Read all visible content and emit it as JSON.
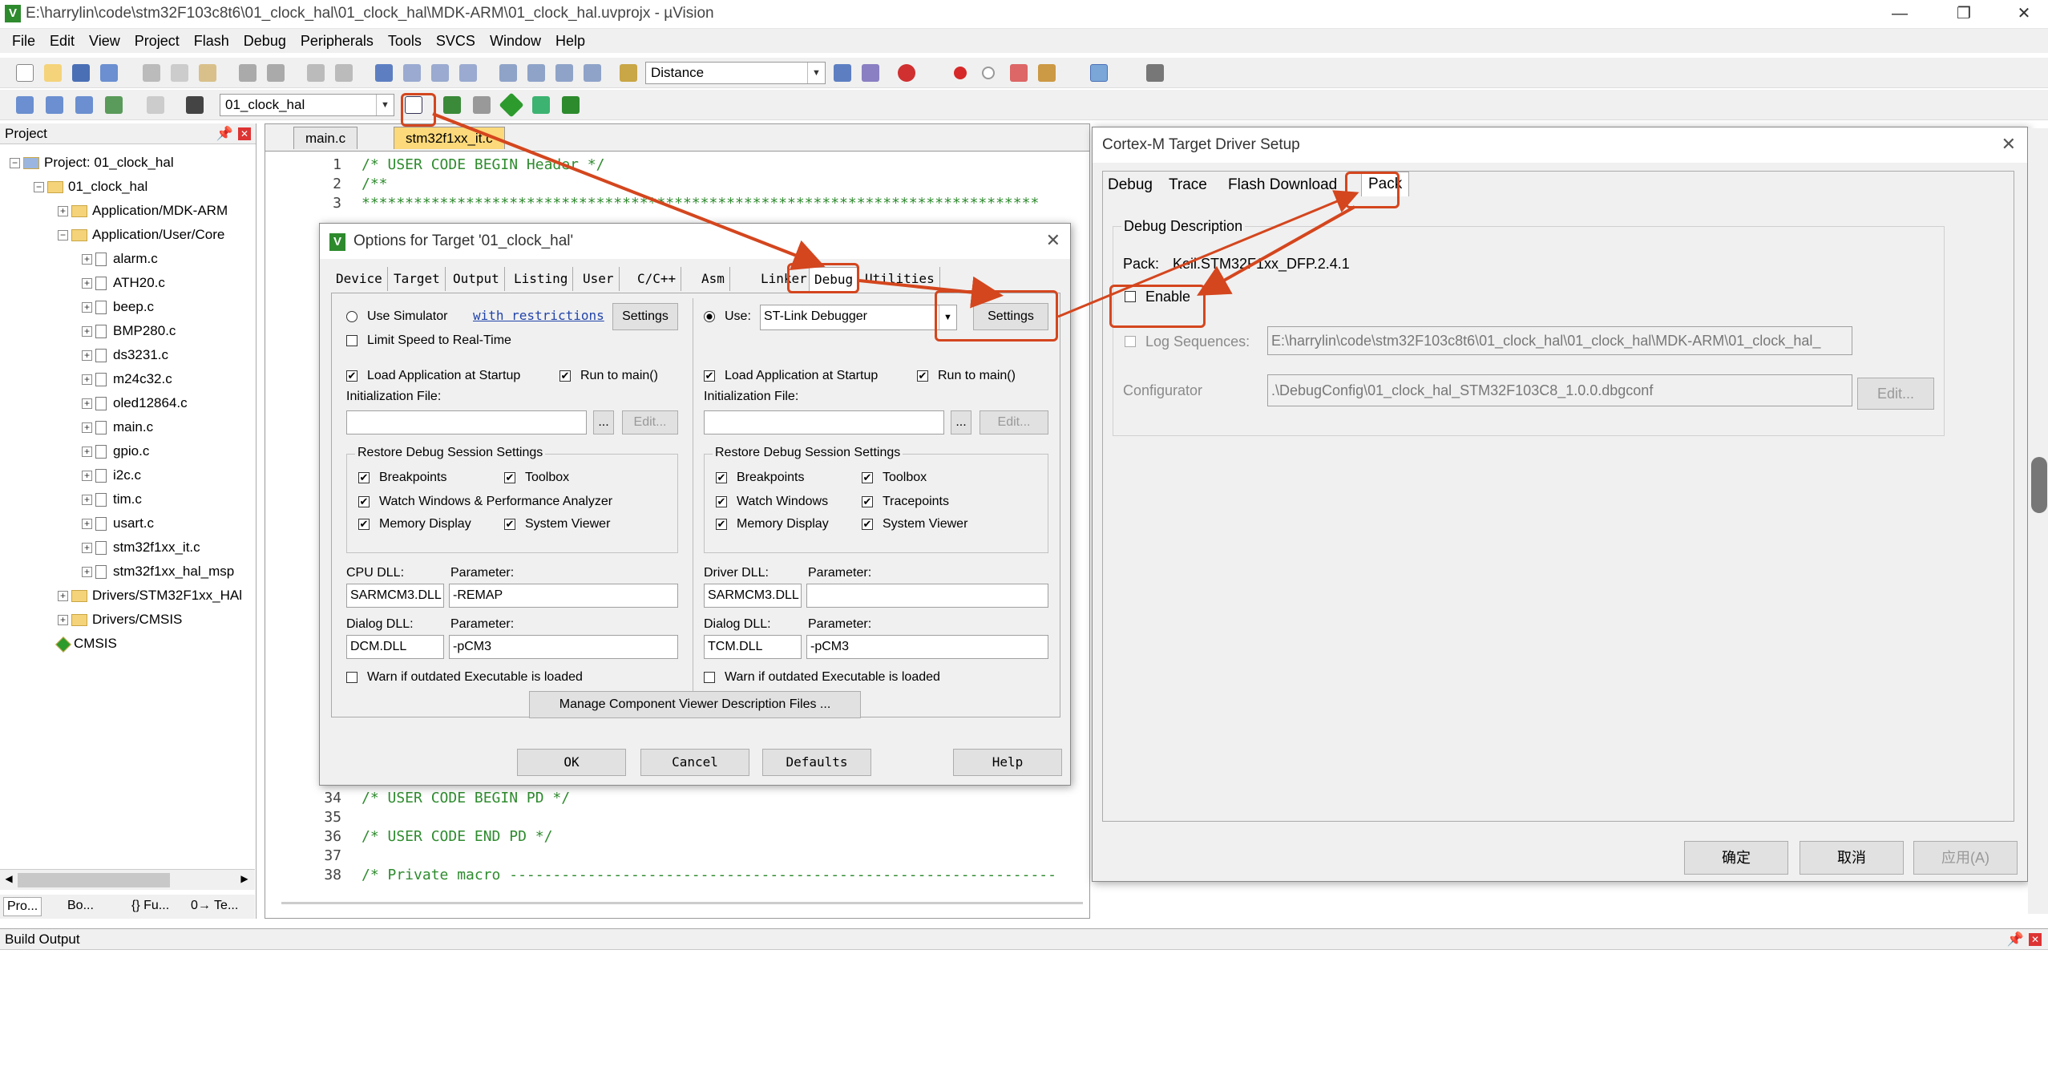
{
  "window": {
    "title": "E:\\harrylin\\code\\stm32F103c8t6\\01_clock_hal\\01_clock_hal\\MDK-ARM\\01_clock_hal.uvprojx - µVision",
    "app_icon": "V",
    "minimize_glyph": "—",
    "maximize_glyph": "❐",
    "close_glyph": "✕"
  },
  "menu": [
    "File",
    "Edit",
    "View",
    "Project",
    "Flash",
    "Debug",
    "Peripherals",
    "Tools",
    "SVCS",
    "Window",
    "Help"
  ],
  "toolbar": {
    "find_combo_value": "Distance",
    "target_combo_value": "01_clock_hal"
  },
  "project_panel": {
    "title": "Project",
    "items": [
      {
        "label": "Project: 01_clock_hal",
        "type": "root",
        "expander": "⊟"
      },
      {
        "label": "01_clock_hal",
        "type": "target",
        "expander": "⊟"
      },
      {
        "label": "Application/MDK-ARM",
        "type": "folder",
        "expander": "⊞"
      },
      {
        "label": "Application/User/Core",
        "type": "folder",
        "expander": "⊟"
      },
      {
        "label": "alarm.c",
        "type": "file",
        "expander": "⊞"
      },
      {
        "label": "ATH20.c",
        "type": "file",
        "expander": "⊞"
      },
      {
        "label": "beep.c",
        "type": "file",
        "expander": "⊞"
      },
      {
        "label": "BMP280.c",
        "type": "file",
        "expander": "⊞"
      },
      {
        "label": "ds3231.c",
        "type": "file",
        "expander": "⊞"
      },
      {
        "label": "m24c32.c",
        "type": "file",
        "expander": "⊞"
      },
      {
        "label": "oled12864.c",
        "type": "file",
        "expander": "⊞"
      },
      {
        "label": "main.c",
        "type": "file",
        "expander": "⊞"
      },
      {
        "label": "gpio.c",
        "type": "file",
        "expander": "⊞"
      },
      {
        "label": "i2c.c",
        "type": "file",
        "expander": "⊞"
      },
      {
        "label": "tim.c",
        "type": "file",
        "expander": "⊞"
      },
      {
        "label": "usart.c",
        "type": "file",
        "expander": "⊞"
      },
      {
        "label": "stm32f1xx_it.c",
        "type": "file",
        "expander": "⊞"
      },
      {
        "label": "stm32f1xx_hal_msp",
        "type": "file",
        "expander": "⊞"
      },
      {
        "label": "Drivers/STM32F1xx_HAl",
        "type": "folder",
        "expander": "⊞"
      },
      {
        "label": "Drivers/CMSIS",
        "type": "folder",
        "expander": "⊞"
      },
      {
        "label": "CMSIS",
        "type": "component",
        "expander": ""
      }
    ],
    "bottom_tabs": [
      "Pro...",
      "Bo...",
      "{} Fu...",
      "0→ Te..."
    ]
  },
  "editor": {
    "tabs": [
      "main.c",
      "stm32f1xx_it.c"
    ],
    "lines_top": [
      {
        "n": "1",
        "t": "/* USER CODE BEGIN Header */"
      },
      {
        "n": "2",
        "t": "/**"
      },
      {
        "n": "3",
        "t": "  ******************************************************************************"
      }
    ],
    "lines_bottom": [
      {
        "n": "34",
        "t": "/* USER CODE BEGIN PD */"
      },
      {
        "n": "35",
        "t": ""
      },
      {
        "n": "36",
        "t": "/* USER CODE END PD */"
      },
      {
        "n": "37",
        "t": ""
      },
      {
        "n": "38",
        "t": "/* Private macro ---------------------------------------------------------------"
      }
    ]
  },
  "options_dialog": {
    "title": "Options for Target '01_clock_hal'",
    "tabs": [
      "Device",
      "Target",
      "Output",
      "Listing",
      "User",
      "C/C++",
      "Asm",
      "Linker",
      "Debug",
      "Utilities"
    ],
    "left": {
      "use_simulator": "Use Simulator",
      "with_restrictions": "with restrictions",
      "settings": "Settings",
      "limit_speed": "Limit Speed to Real-Time",
      "load_app": "Load Application at Startup",
      "run_to_main": "Run to main()",
      "init_file": "Initialization File:",
      "dots": "...",
      "edit": "Edit...",
      "restore_group": "Restore Debug Session Settings",
      "breakpoints": "Breakpoints",
      "toolbox": "Toolbox",
      "watch": "Watch Windows & Performance Analyzer",
      "memory": "Memory Display",
      "system_viewer": "System Viewer",
      "cpu_dll_label": "CPU DLL:",
      "param_label": "Parameter:",
      "cpu_dll": "SARMCM3.DLL",
      "cpu_param": "-REMAP",
      "dialog_dll_label": "Dialog DLL:",
      "dialog_dll": "DCM.DLL",
      "dialog_param": "-pCM3",
      "warn": "Warn if outdated Executable is loaded"
    },
    "right": {
      "use": "Use:",
      "debugger": "ST-Link Debugger",
      "settings": "Settings",
      "load_app": "Load Application at Startup",
      "run_to_main": "Run to main()",
      "init_file": "Initialization File:",
      "dots": "...",
      "edit": "Edit...",
      "restore_group": "Restore Debug Session Settings",
      "breakpoints": "Breakpoints",
      "toolbox": "Toolbox",
      "watch": "Watch Windows",
      "tracepoints": "Tracepoints",
      "memory": "Memory Display",
      "system_viewer": "System Viewer",
      "driver_dll_label": "Driver DLL:",
      "param_label": "Parameter:",
      "driver_dll": "SARMCM3.DLL",
      "driver_param": "",
      "dialog_dll_label": "Dialog DLL:",
      "dialog_dll": "TCM.DLL",
      "dialog_param": "-pCM3",
      "warn": "Warn if outdated Executable is loaded"
    },
    "manage_btn": "Manage Component Viewer Description Files ...",
    "ok": "OK",
    "cancel": "Cancel",
    "defaults": "Defaults",
    "help": "Help"
  },
  "cortex_dialog": {
    "title": "Cortex-M Target Driver Setup",
    "tabs": [
      "Debug",
      "Trace",
      "Flash Download",
      "Pack"
    ],
    "group": "Debug Description",
    "pack_label": "Pack:",
    "pack_value": "Keil.STM32F1xx_DFP.2.4.1",
    "enable": "Enable",
    "log_label": "Log Sequences:",
    "log_path": "E:\\harrylin\\code\\stm32F103c8t6\\01_clock_hal\\01_clock_hal\\MDK-ARM\\01_clock_hal_",
    "config_label": "Configurator",
    "config_path": ".\\DebugConfig\\01_clock_hal_STM32F103C8_1.0.0.dbgconf",
    "edit": "Edit...",
    "ok": "确定",
    "cancel": "取消",
    "apply": "应用(A)"
  },
  "build_output": {
    "title": "Build Output"
  },
  "colors": {
    "annotation": "#d4461e",
    "code_comment": "#2e8b2e"
  }
}
